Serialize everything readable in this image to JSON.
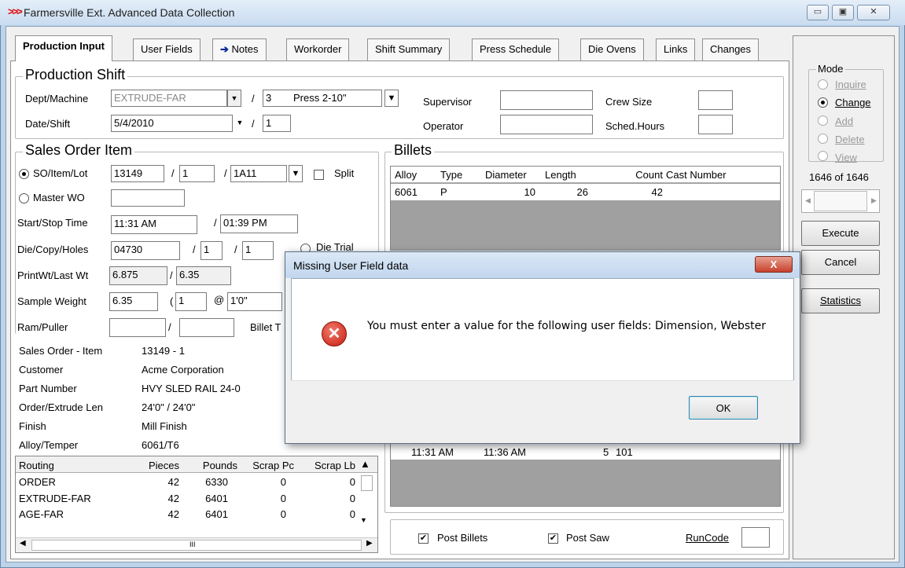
{
  "window": {
    "title": "Farmersville Ext. Advanced Data Collection",
    "app_icon": "triple-chevron-icon"
  },
  "tabs": [
    {
      "label": "Production Input"
    },
    {
      "label": "User Fields"
    },
    {
      "label": "Notes",
      "icon": "arrow-right-icon"
    },
    {
      "label": "Workorder"
    },
    {
      "label": "Shift Summary"
    },
    {
      "label": "Press Schedule"
    },
    {
      "label": "Die Ovens"
    },
    {
      "label": "Links"
    },
    {
      "label": "Changes"
    }
  ],
  "production_shift": {
    "title": "Production Shift",
    "dept_label": "Dept/Machine",
    "dept_value": "EXTRUDE-FAR",
    "machine_num": "3",
    "machine_name": "Press 2-10\"",
    "date_label": "Date/Shift",
    "date_value": "5/4/2010",
    "shift_value": "1",
    "supervisor_label": "Supervisor",
    "operator_label": "Operator",
    "crew_label": "Crew Size",
    "sched_label": "Sched.Hours",
    "slash": "/"
  },
  "sales_order": {
    "title": "Sales Order Item",
    "so_label": "SO/Item/Lot",
    "so_value": "13149",
    "item_value": "1",
    "lot_value": "1A11",
    "split_label": "Split",
    "master_label": "Master WO",
    "start_label": "Start/Stop Time",
    "start_value": "11:31 AM",
    "stop_value": "01:39 PM",
    "die_label": "Die/Copy/Holes",
    "die_value": "04730",
    "copy_value": "1",
    "holes_value": "1",
    "die_trial_label": "Die Trial",
    "printwt_label": "PrintWt/Last Wt",
    "printwt_value": "6.875",
    "lastwt_value": "6.35",
    "sample_label": "Sample Weight",
    "sample_value": "6.35",
    "paren": "(",
    "sample_qty": "1",
    "at": "@",
    "sample_len": "1'0\"",
    "ram_label": "Ram/Puller",
    "billet_t_label": "Billet T"
  },
  "order_info": [
    {
      "label": "Sales Order - Item",
      "value": "13149 - 1"
    },
    {
      "label": "Customer",
      "value": "Acme Corporation"
    },
    {
      "label": "Part Number",
      "value": "HVY SLED RAIL 24-0"
    },
    {
      "label": "Order/Extrude Len",
      "value": "24'0\"  /  24'0\""
    },
    {
      "label": "Finish",
      "value": "Mill Finish"
    },
    {
      "label": "Alloy/Temper",
      "value": "6061/T6"
    }
  ],
  "routing": {
    "headers": [
      "Routing",
      "Pieces",
      "Pounds",
      "Scrap Pc",
      "Scrap Lb"
    ],
    "rows": [
      [
        "ORDER",
        "42",
        "6330",
        "0",
        "0"
      ],
      [
        "EXTRUDE-FAR",
        "42",
        "6401",
        "0",
        "0"
      ],
      [
        "AGE-FAR",
        "42",
        "6401",
        "0",
        "0"
      ]
    ],
    "scroll_glyph": "III"
  },
  "billets": {
    "title": "Billets",
    "headers": [
      "Alloy",
      "Type",
      "Diameter",
      "Length",
      "Count",
      "Cast Number"
    ],
    "rows": [
      [
        "6061",
        "P",
        "10",
        "26",
        "42",
        ""
      ]
    ]
  },
  "pieces": {
    "row": [
      "11:31 AM",
      "11:36 AM",
      "5",
      "101"
    ]
  },
  "bottom": {
    "post_billets": "Post Billets",
    "post_saw": "Post Saw",
    "runcode": "RunCode"
  },
  "sidebar": {
    "mode_title": "Mode",
    "modes": [
      {
        "label": "Inquire",
        "selected": false,
        "enabled": false
      },
      {
        "label": "Change",
        "selected": true,
        "enabled": true
      },
      {
        "label": "Add",
        "selected": false,
        "enabled": false
      },
      {
        "label": "Delete",
        "selected": false,
        "enabled": false
      },
      {
        "label": "View",
        "selected": false,
        "enabled": false
      }
    ],
    "record_counter": "1646 of 1646",
    "execute": "Execute",
    "cancel": "Cancel",
    "statistics": "Statistics"
  },
  "dialog": {
    "title": "Missing User Field data",
    "message": "You must enter a value for the following user fields: Dimension, Webster",
    "ok": "OK",
    "close": "X"
  }
}
